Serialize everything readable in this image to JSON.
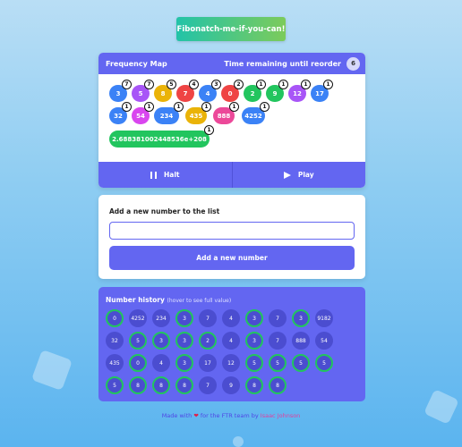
{
  "app": {
    "title": "Fibonatch-me-if-you-can!"
  },
  "frequency_map": {
    "title": "Frequency Map",
    "timer_label": "Time remaining until reorder",
    "timer_value": "6",
    "items": [
      {
        "value": "3",
        "count": "7",
        "color": "#3b82f6"
      },
      {
        "value": "5",
        "count": "7",
        "color": "#a855f7"
      },
      {
        "value": "8",
        "count": "5",
        "color": "#eab308"
      },
      {
        "value": "7",
        "count": "4",
        "color": "#ef4444"
      },
      {
        "value": "4",
        "count": "3",
        "color": "#3b82f6"
      },
      {
        "value": "0",
        "count": "2",
        "color": "#ef4444"
      },
      {
        "value": "2",
        "count": "1",
        "color": "#22c55e"
      },
      {
        "value": "9",
        "count": "1",
        "color": "#22c55e"
      },
      {
        "value": "12",
        "count": "1",
        "color": "#a855f7"
      },
      {
        "value": "17",
        "count": "1",
        "color": "#3b82f6"
      },
      {
        "value": "32",
        "count": "1",
        "color": "#3b82f6"
      },
      {
        "value": "54",
        "count": "1",
        "color": "#d946ef"
      },
      {
        "value": "234",
        "count": "1",
        "color": "#3b82f6"
      },
      {
        "value": "435",
        "count": "1",
        "color": "#eab308"
      },
      {
        "value": "888",
        "count": "1",
        "color": "#ec4899"
      },
      {
        "value": "4252",
        "count": "1",
        "color": "#3b82f6"
      },
      {
        "value": "2.688381002448536e+208",
        "count": "1",
        "color": "#22c55e"
      }
    ],
    "halt_label": "Halt",
    "play_label": "Play"
  },
  "add_form": {
    "label": "Add a new number to the list",
    "input_value": "",
    "button_label": "Add a new number"
  },
  "history": {
    "title": "Number history",
    "hint": "(hover to see full value)",
    "items": [
      {
        "value": "0",
        "fib": true
      },
      {
        "value": "4252",
        "fib": false
      },
      {
        "value": "234",
        "fib": false
      },
      {
        "value": "3",
        "fib": true
      },
      {
        "value": "7",
        "fib": false
      },
      {
        "value": "4",
        "fib": false
      },
      {
        "value": "3",
        "fib": true
      },
      {
        "value": "7",
        "fib": false
      },
      {
        "value": "3",
        "fib": true
      },
      {
        "value": "9182",
        "fib": false
      },
      {
        "value": "32",
        "fib": false
      },
      {
        "value": "5",
        "fib": true
      },
      {
        "value": "3",
        "fib": true
      },
      {
        "value": "3",
        "fib": true
      },
      {
        "value": "2",
        "fib": true
      },
      {
        "value": "4",
        "fib": false
      },
      {
        "value": "3",
        "fib": true
      },
      {
        "value": "7",
        "fib": false
      },
      {
        "value": "888",
        "fib": false
      },
      {
        "value": "54",
        "fib": false
      },
      {
        "value": "435",
        "fib": false
      },
      {
        "value": "0",
        "fib": true
      },
      {
        "value": "4",
        "fib": false
      },
      {
        "value": "3",
        "fib": true
      },
      {
        "value": "17",
        "fib": false
      },
      {
        "value": "12",
        "fib": false
      },
      {
        "value": "5",
        "fib": true
      },
      {
        "value": "5",
        "fib": true
      },
      {
        "value": "5",
        "fib": true
      },
      {
        "value": "5",
        "fib": true
      },
      {
        "value": "5",
        "fib": true
      },
      {
        "value": "8",
        "fib": true
      },
      {
        "value": "8",
        "fib": true
      },
      {
        "value": "8",
        "fib": true
      },
      {
        "value": "7",
        "fib": false
      },
      {
        "value": "9",
        "fib": false
      },
      {
        "value": "8",
        "fib": true
      },
      {
        "value": "8",
        "fib": true
      }
    ]
  },
  "footer": {
    "made_with": "Made with",
    "heart_icon": "heart-icon",
    "for_text": "for the FTR team by",
    "author": "Isaac Johnson"
  },
  "colors": {
    "accent": "#6366f1",
    "fib_ring": "#22c55e"
  }
}
